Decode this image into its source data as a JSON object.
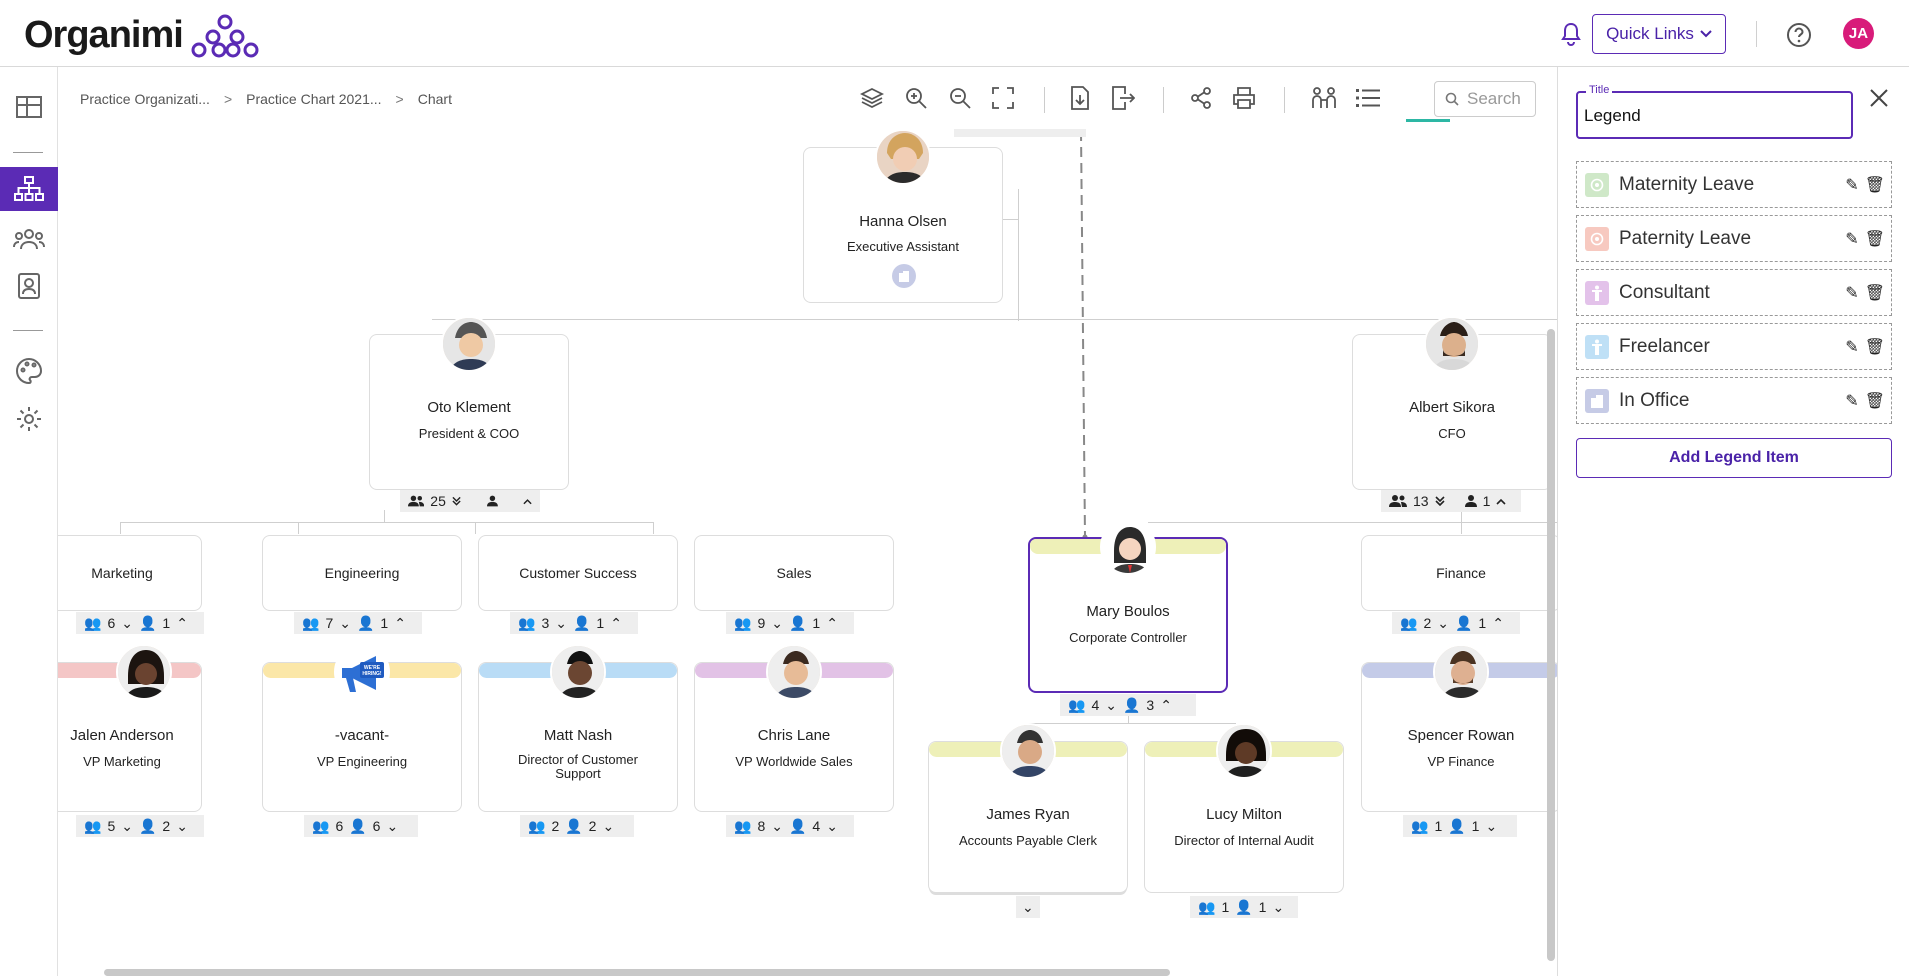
{
  "header": {
    "logo_text": "Organimi",
    "quick_links_label": "Quick Links",
    "user_initials": "JA",
    "accent_color": "#5b2bb5",
    "avatar_color": "#d81b7a"
  },
  "nav": {
    "items": [
      "grid-icon",
      "org-chart-icon",
      "people-icon",
      "directory-icon",
      "palette-icon",
      "settings-icon"
    ],
    "active": "org-chart-icon"
  },
  "breadcrumb": {
    "items": [
      "Practice Organizati...",
      "Practice Chart 2021...",
      "Chart"
    ]
  },
  "toolbar": {
    "search_placeholder": "Search",
    "tools": [
      "layers-icon",
      "zoom-in-icon",
      "zoom-out-icon",
      "fullscreen-icon",
      "import-icon",
      "export-icon",
      "share-icon",
      "print-icon",
      "compare-icon",
      "legend-list-icon"
    ]
  },
  "chart": {
    "exec_assistant": {
      "name": "Hanna Olsen",
      "role": "Executive Assistant"
    },
    "oto": {
      "name": "Oto Klement",
      "role": "President & COO",
      "count_people": "25",
      "count_direct": ""
    },
    "albert": {
      "name": "Albert Sikora",
      "role": "CFO",
      "count_people": "13",
      "count_direct": "1"
    },
    "mary": {
      "name": "Mary Boulos",
      "role": "Corporate Controller",
      "count_people": "4",
      "count_direct": "3"
    },
    "departments": [
      {
        "name": "Marketing",
        "count_people": "6",
        "count_direct": "1"
      },
      {
        "name": "Engineering",
        "count_people": "7",
        "count_direct": "1"
      },
      {
        "name": "Customer Success",
        "count_people": "3",
        "count_direct": "1"
      },
      {
        "name": "Sales",
        "count_people": "9",
        "count_direct": "1"
      },
      {
        "name": "Finance",
        "count_people": "2",
        "count_direct": "1"
      }
    ],
    "vps": [
      {
        "name": "Jalen Anderson",
        "role": "VP Marketing",
        "count_people": "5",
        "count_direct": "2",
        "stripe": "#f4c6c6"
      },
      {
        "name": "-vacant-",
        "role": "VP Engineering",
        "count_people": "6",
        "count_direct": "6",
        "stripe": "#fbe7a8",
        "hiring_badge": "WE'RE HIRING!"
      },
      {
        "name": "Matt Nash",
        "role": "Director of Customer Support",
        "count_people": "2",
        "count_direct": "2",
        "stripe": "#b9dcf6"
      },
      {
        "name": "Chris Lane",
        "role": "VP Worldwide Sales",
        "count_people": "8",
        "count_direct": "4",
        "stripe": "#e2c2e6"
      },
      {
        "name": "Spencer Rowan",
        "role": "VP Finance",
        "count_people": "1",
        "count_direct": "1",
        "stripe": "#c4cbe8"
      }
    ],
    "james": {
      "name": "James Ryan",
      "role": "Accounts Payable Clerk"
    },
    "lucy": {
      "name": "Lucy Milton",
      "role": "Director of Internal Audit",
      "count_people": "1",
      "count_direct": "1"
    }
  },
  "legend_panel": {
    "title_label": "Title",
    "title_value": "Legend",
    "items": [
      {
        "label": "Maternity Leave",
        "icon": "maternity-icon",
        "color": "#cfe8c8"
      },
      {
        "label": "Paternity Leave",
        "icon": "paternity-icon",
        "color": "#f7c9c0"
      },
      {
        "label": "Consultant",
        "icon": "consultant-icon",
        "color": "#e3c2ea"
      },
      {
        "label": "Freelancer",
        "icon": "freelancer-icon",
        "color": "#bfe0f6"
      },
      {
        "label": "In Office",
        "icon": "office-icon",
        "color": "#c6cbe6"
      }
    ],
    "add_label": "Add Legend Item"
  }
}
